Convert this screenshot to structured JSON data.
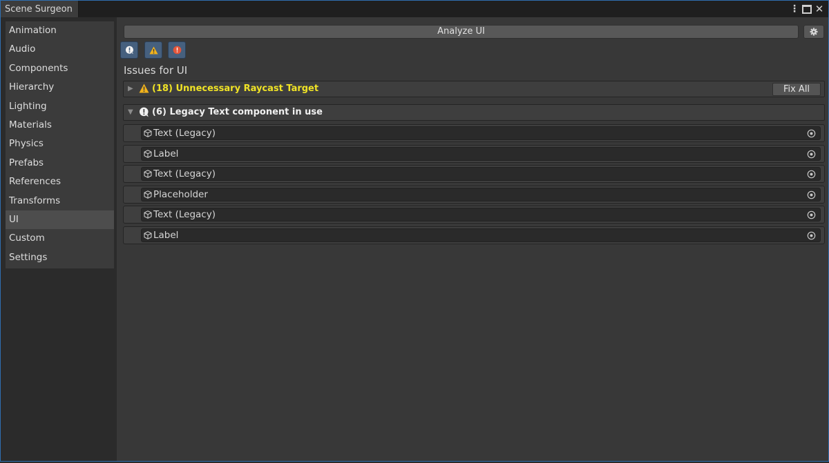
{
  "window": {
    "tab_title": "Scene Surgeon",
    "controls": [
      "kebab-menu-icon",
      "maximize-icon",
      "close-icon"
    ]
  },
  "sidebar": {
    "items": [
      {
        "label": "Animation"
      },
      {
        "label": "Audio"
      },
      {
        "label": "Components"
      },
      {
        "label": "Hierarchy"
      },
      {
        "label": "Lighting"
      },
      {
        "label": "Materials"
      },
      {
        "label": "Physics"
      },
      {
        "label": "Prefabs"
      },
      {
        "label": "References"
      },
      {
        "label": "Transforms"
      },
      {
        "label": "UI",
        "selected": true
      },
      {
        "label": "Custom"
      },
      {
        "label": "Settings"
      }
    ]
  },
  "main": {
    "analyze_label": "Analyze UI",
    "issues_title": "Issues for UI",
    "filters": [
      "info-filter-icon",
      "warning-filter-icon",
      "error-filter-icon"
    ],
    "groups": [
      {
        "title": "(18) Unnecessary Raycast Target",
        "severity": "warning",
        "expanded": false,
        "fix_label": "Fix All"
      },
      {
        "title": "(6) Legacy Text component in use",
        "severity": "info",
        "expanded": true,
        "items": [
          {
            "label": "Text (Legacy)"
          },
          {
            "label": "Label"
          },
          {
            "label": "Text (Legacy)"
          },
          {
            "label": "Placeholder"
          },
          {
            "label": "Text (Legacy)"
          },
          {
            "label": "Label"
          }
        ]
      }
    ]
  },
  "colors": {
    "accent_border": "#2f6fb1",
    "warning_text": "#f0e326",
    "warning_icon": "#f2b31b",
    "error_icon": "#e4553a",
    "filter_button": "#46607e"
  }
}
